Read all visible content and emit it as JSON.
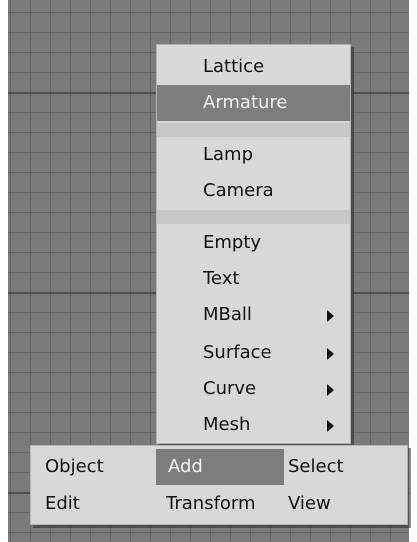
{
  "add_menu": {
    "items": [
      {
        "label": "Lattice"
      },
      {
        "label": "Armature"
      },
      {
        "label": "Lamp"
      },
      {
        "label": "Camera"
      },
      {
        "label": "Empty"
      },
      {
        "label": "Text"
      },
      {
        "label": "MBall"
      },
      {
        "label": "Surface"
      },
      {
        "label": "Curve"
      },
      {
        "label": "Mesh"
      }
    ],
    "selected": "Armature"
  },
  "toolbar": {
    "row1": [
      "Object",
      "Add",
      "Select"
    ],
    "row2": [
      "Edit",
      "Transform",
      "View"
    ],
    "active": "Add"
  },
  "colors": {
    "menu_bg": "#d8d8d8",
    "highlight": "#7d7d7d",
    "grid_bg": "#7a7a7a"
  }
}
